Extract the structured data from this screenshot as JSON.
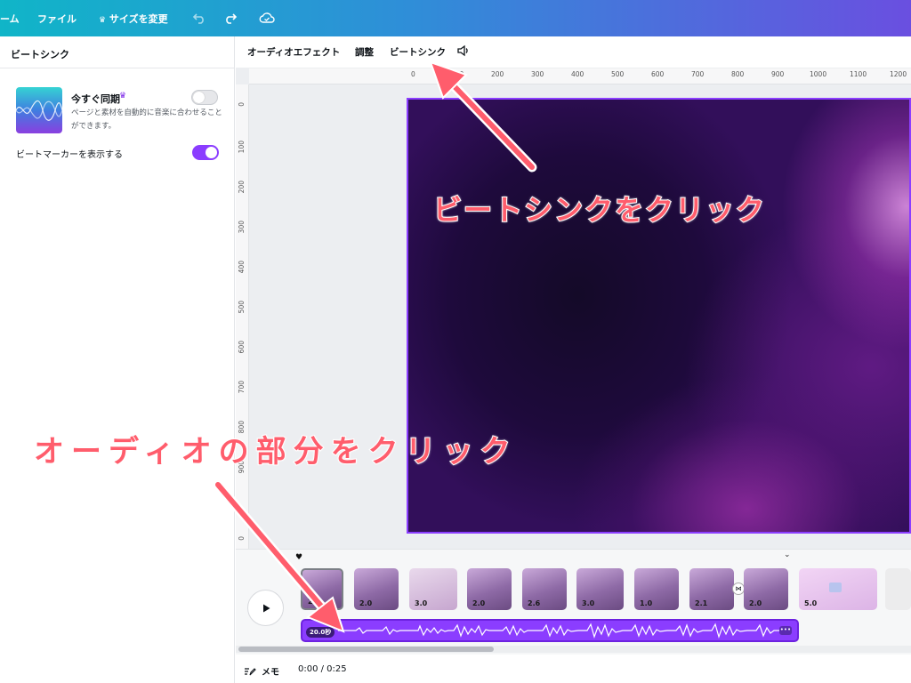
{
  "topbar": {
    "home_partial": "ーム",
    "file": "ファイル",
    "resize": "サイズを変更"
  },
  "left_panel": {
    "title": "ビートシンク",
    "sync_now": {
      "title": "今すぐ同期",
      "description": "ページと素材を自動的に音楽に合わせることができます。",
      "enabled": false
    },
    "show_markers": {
      "label": "ビートマーカーを表示する",
      "enabled": true
    }
  },
  "toolbar": {
    "audio_effects": "オーディオエフェクト",
    "adjust": "調整",
    "beat_sync": "ビートシンク"
  },
  "ruler": {
    "top": [
      "0",
      "100",
      "200",
      "300",
      "400",
      "500",
      "600",
      "700",
      "800",
      "900",
      "1000",
      "1100",
      "1200"
    ],
    "left": [
      "0",
      "100",
      "200",
      "300",
      "400",
      "500",
      "600",
      "700",
      "800",
      "900",
      "0"
    ]
  },
  "annotations": {
    "click_beat_sync": "ビートシンクをクリック",
    "click_audio": "オーディオの部分をクリック"
  },
  "timeline": {
    "clips": [
      "2.0",
      "2.0",
      "3.0",
      "2.0",
      "2.6",
      "3.0",
      "1.0",
      "2.1",
      "2.0",
      "5.0"
    ],
    "audio_duration": "20.0秒",
    "memo": "メモ",
    "time": "0:00 / 0:25"
  },
  "colors": {
    "accent": "#8b3dff",
    "annotation": "#ff5d6c"
  }
}
